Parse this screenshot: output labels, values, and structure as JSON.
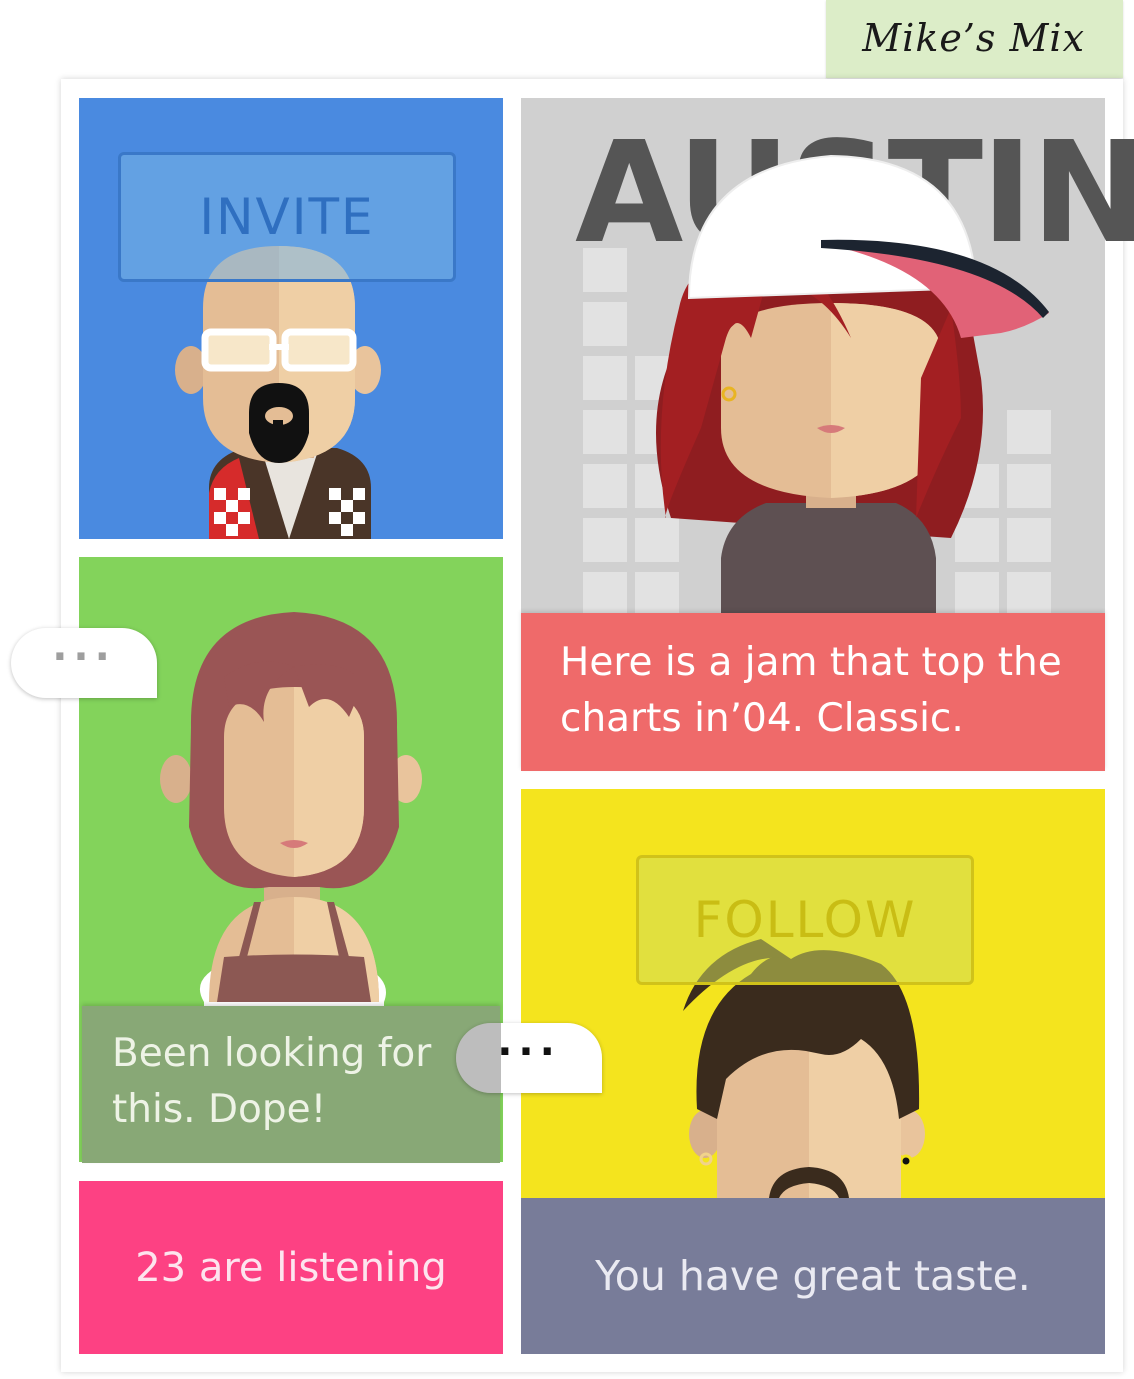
{
  "header": {
    "title": "Mike’s Mix"
  },
  "tiles": {
    "invite": {
      "button_label": "INVITE"
    },
    "featured": {
      "city": "AUSTIN",
      "message": "Here is a jam that top the charts in’04. Classic."
    },
    "listener": {
      "message": "Been looking for this. Dope!"
    },
    "follow": {
      "button_label": "FOLLOW"
    }
  },
  "status": {
    "listening": "23 are listening",
    "compliment": "You have great taste."
  },
  "typing_indicator": {
    "dots": "···"
  },
  "colors": {
    "invite_tile": "#4a8ae0",
    "featured_tile": "#d0d0d0",
    "listener_tile": "#83d35b",
    "follow_tile": "#f4e41e",
    "message_red": "#ef6a6a",
    "message_green": "#88a876",
    "listening_pink": "#fd4183",
    "compliment_purple": "#787c99",
    "title_tab": "#dcedc8"
  }
}
